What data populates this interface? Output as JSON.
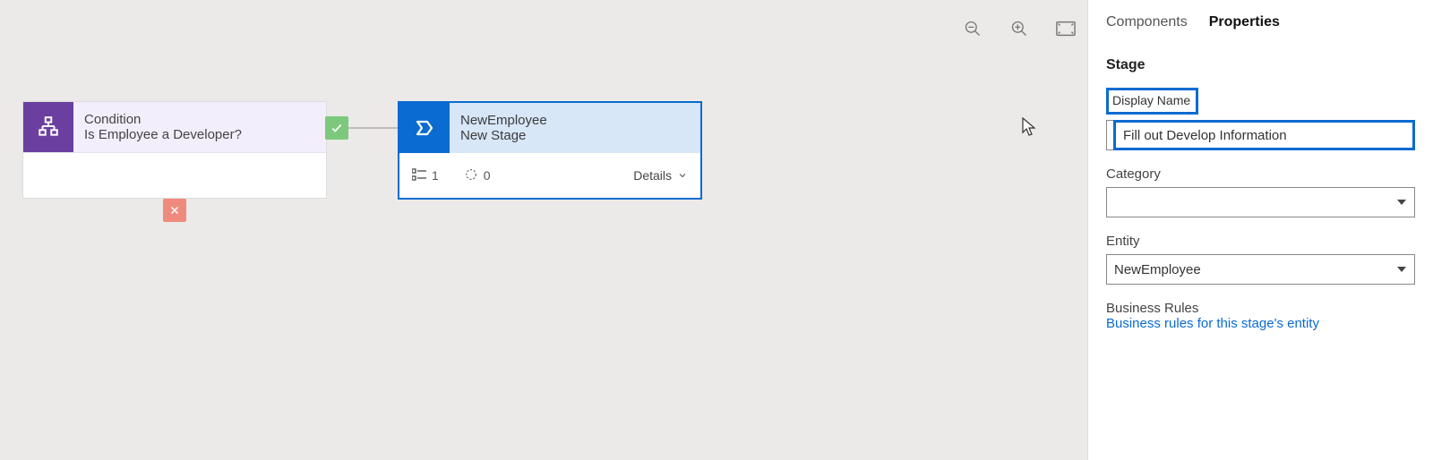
{
  "toolbar": {
    "zoom_out_icon": "zoom-out",
    "zoom_in_icon": "zoom-in",
    "fit_icon": "fit-to-screen"
  },
  "canvas": {
    "condition": {
      "type_label": "Condition",
      "title": "Is Employee a Developer?"
    },
    "stage": {
      "entity": "NewEmployee",
      "title": "New Stage",
      "steps_count": "1",
      "workflows_count": "0",
      "details_label": "Details"
    }
  },
  "panel": {
    "tabs": {
      "components": "Components",
      "properties": "Properties",
      "active": "properties"
    },
    "section": "Stage",
    "display_name": {
      "label": "Display Name",
      "value": "Fill out Develop Information"
    },
    "category": {
      "label": "Category",
      "value": ""
    },
    "entity": {
      "label": "Entity",
      "value": "NewEmployee"
    },
    "business_rules": {
      "label": "Business Rules",
      "link": "Business rules for this stage's entity"
    }
  }
}
